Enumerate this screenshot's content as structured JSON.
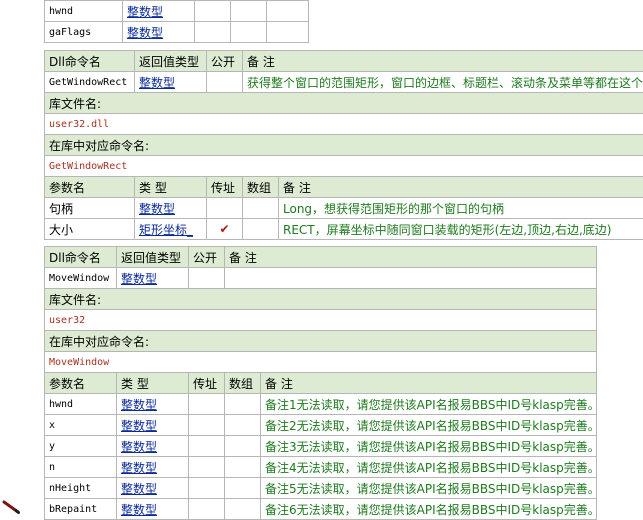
{
  "top_rows": [
    {
      "name": "hwnd",
      "type": "整数型"
    },
    {
      "name": "gaFlags",
      "type": "整数型"
    }
  ],
  "headers": {
    "dll_name": "Dll命令名",
    "return_type": "返回值类型",
    "public": "公开",
    "note": "备 注",
    "lib_label": "库文件名:",
    "lib_cmd_label": "在库中对应命令名:",
    "param_name": "参数名",
    "param_type": "类 型",
    "param_ref": "传址",
    "param_array": "数组",
    "param_note": "备 注"
  },
  "commands": [
    {
      "name": "GetWindowRect",
      "return_type": "整数型",
      "public": "",
      "note": "获得整个窗口的范围矩形，窗口的边框、标题栏、滚动条及菜单等都在这个",
      "lib_file": "user32.dll",
      "lib_cmd": "GetWindowRect",
      "params": [
        {
          "name": "句柄",
          "type": "整数型",
          "ref": "",
          "array": "",
          "note": "Long，想获得范围矩形的那个窗口的句柄"
        },
        {
          "name": "大小",
          "type": "矩形坐标_",
          "ref": "✔",
          "array": "",
          "note": "RECT，屏幕坐标中随同窗口装载的矩形(左边,顶边,右边,底边)"
        }
      ]
    },
    {
      "name": "MoveWindow",
      "return_type": "整数型",
      "public": "",
      "note": "",
      "lib_file": "user32",
      "lib_cmd": "MoveWindow",
      "params": [
        {
          "name": "hwnd",
          "type": "整数型",
          "ref": "",
          "array": "",
          "note": "备注1无法读取，请您提供该API名报易BBS中ID号klasp完善。"
        },
        {
          "name": "x",
          "type": "整数型",
          "ref": "",
          "array": "",
          "note": "备注2无法读取，请您提供该API名报易BBS中ID号klasp完善。"
        },
        {
          "name": "y",
          "type": "整数型",
          "ref": "",
          "array": "",
          "note": "备注3无法读取，请您提供该API名报易BBS中ID号klasp完善。"
        },
        {
          "name": "n",
          "type": "整数型",
          "ref": "",
          "array": "",
          "note": "备注4无法读取，请您提供该API名报易BBS中ID号klasp完善。"
        },
        {
          "name": "nHeight",
          "type": "整数型",
          "ref": "",
          "array": "",
          "note": "备注5无法读取，请您提供该API名报易BBS中ID号klasp完善。"
        },
        {
          "name": "bRepaint",
          "type": "整数型",
          "ref": "",
          "array": "",
          "note": "备注6无法读取，请您提供该API名报易BBS中ID号klasp完善。"
        }
      ]
    }
  ],
  "icons": {
    "cursor": "pencil-icon"
  }
}
